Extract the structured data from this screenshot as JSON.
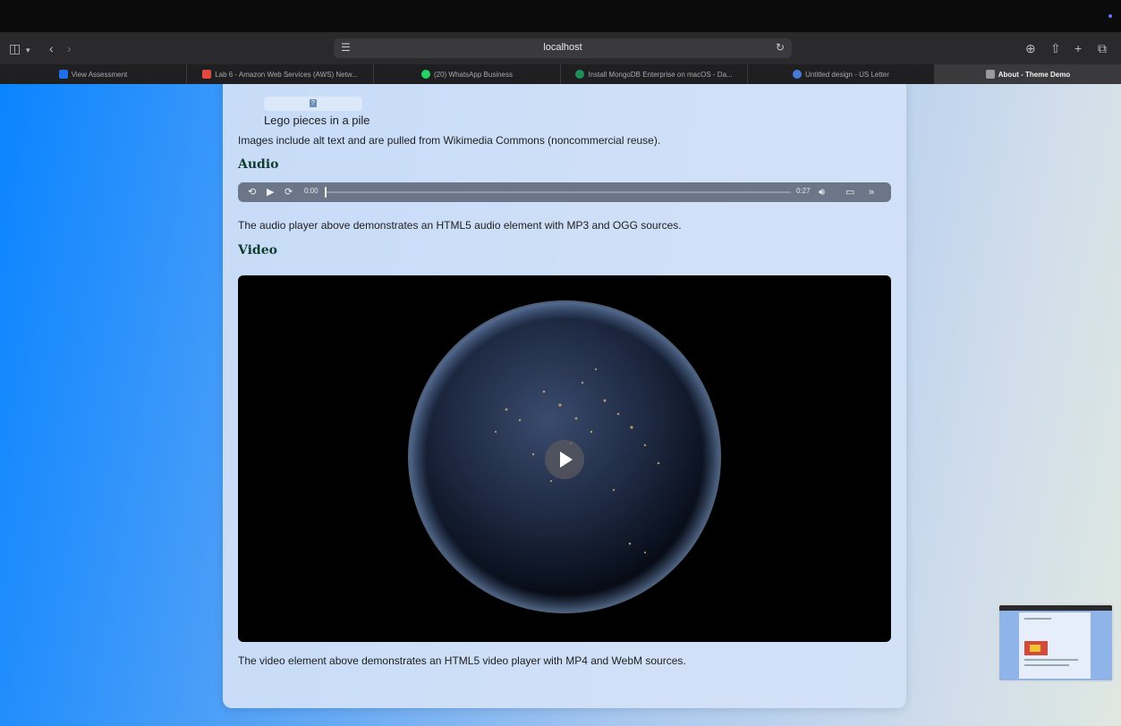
{
  "browser": {
    "url": "localhost",
    "tabs": [
      {
        "label": "View Assessment",
        "icon": "assessment-icon",
        "color": "#1f6feb",
        "active": false
      },
      {
        "label": "Lab 6 - Amazon Web Services (AWS) Netw...",
        "icon": "s-logo-icon",
        "color": "#e5483f",
        "active": false
      },
      {
        "label": "(20) WhatsApp Business",
        "icon": "whatsapp-icon",
        "color": "#25d366",
        "active": false
      },
      {
        "label": "Install MongoDB Enterprise on macOS - Da...",
        "icon": "mongodb-icon",
        "color": "#1e8e5a",
        "active": false
      },
      {
        "label": "Untitled design - US Letter",
        "icon": "canva-icon",
        "color": "#4a7bd8",
        "active": false
      },
      {
        "label": "About - Theme Demo",
        "icon": "theme-demo-icon",
        "color": "#9a9a9e",
        "active": true
      }
    ]
  },
  "page": {
    "image_caption": "Lego pieces in a pile",
    "image_note": "Images include alt text and are pulled from Wikimedia Commons (noncommercial reuse).",
    "audio_heading": "Audio",
    "audio": {
      "current": "0:00",
      "duration": "0:27",
      "progress": 0
    },
    "audio_note": "The audio player above demonstrates an HTML5 audio element with MP3 and OGG sources.",
    "video_heading": "Video",
    "video_note": "The video element above demonstrates an HTML5 video player with MP4 and WebM sources."
  }
}
